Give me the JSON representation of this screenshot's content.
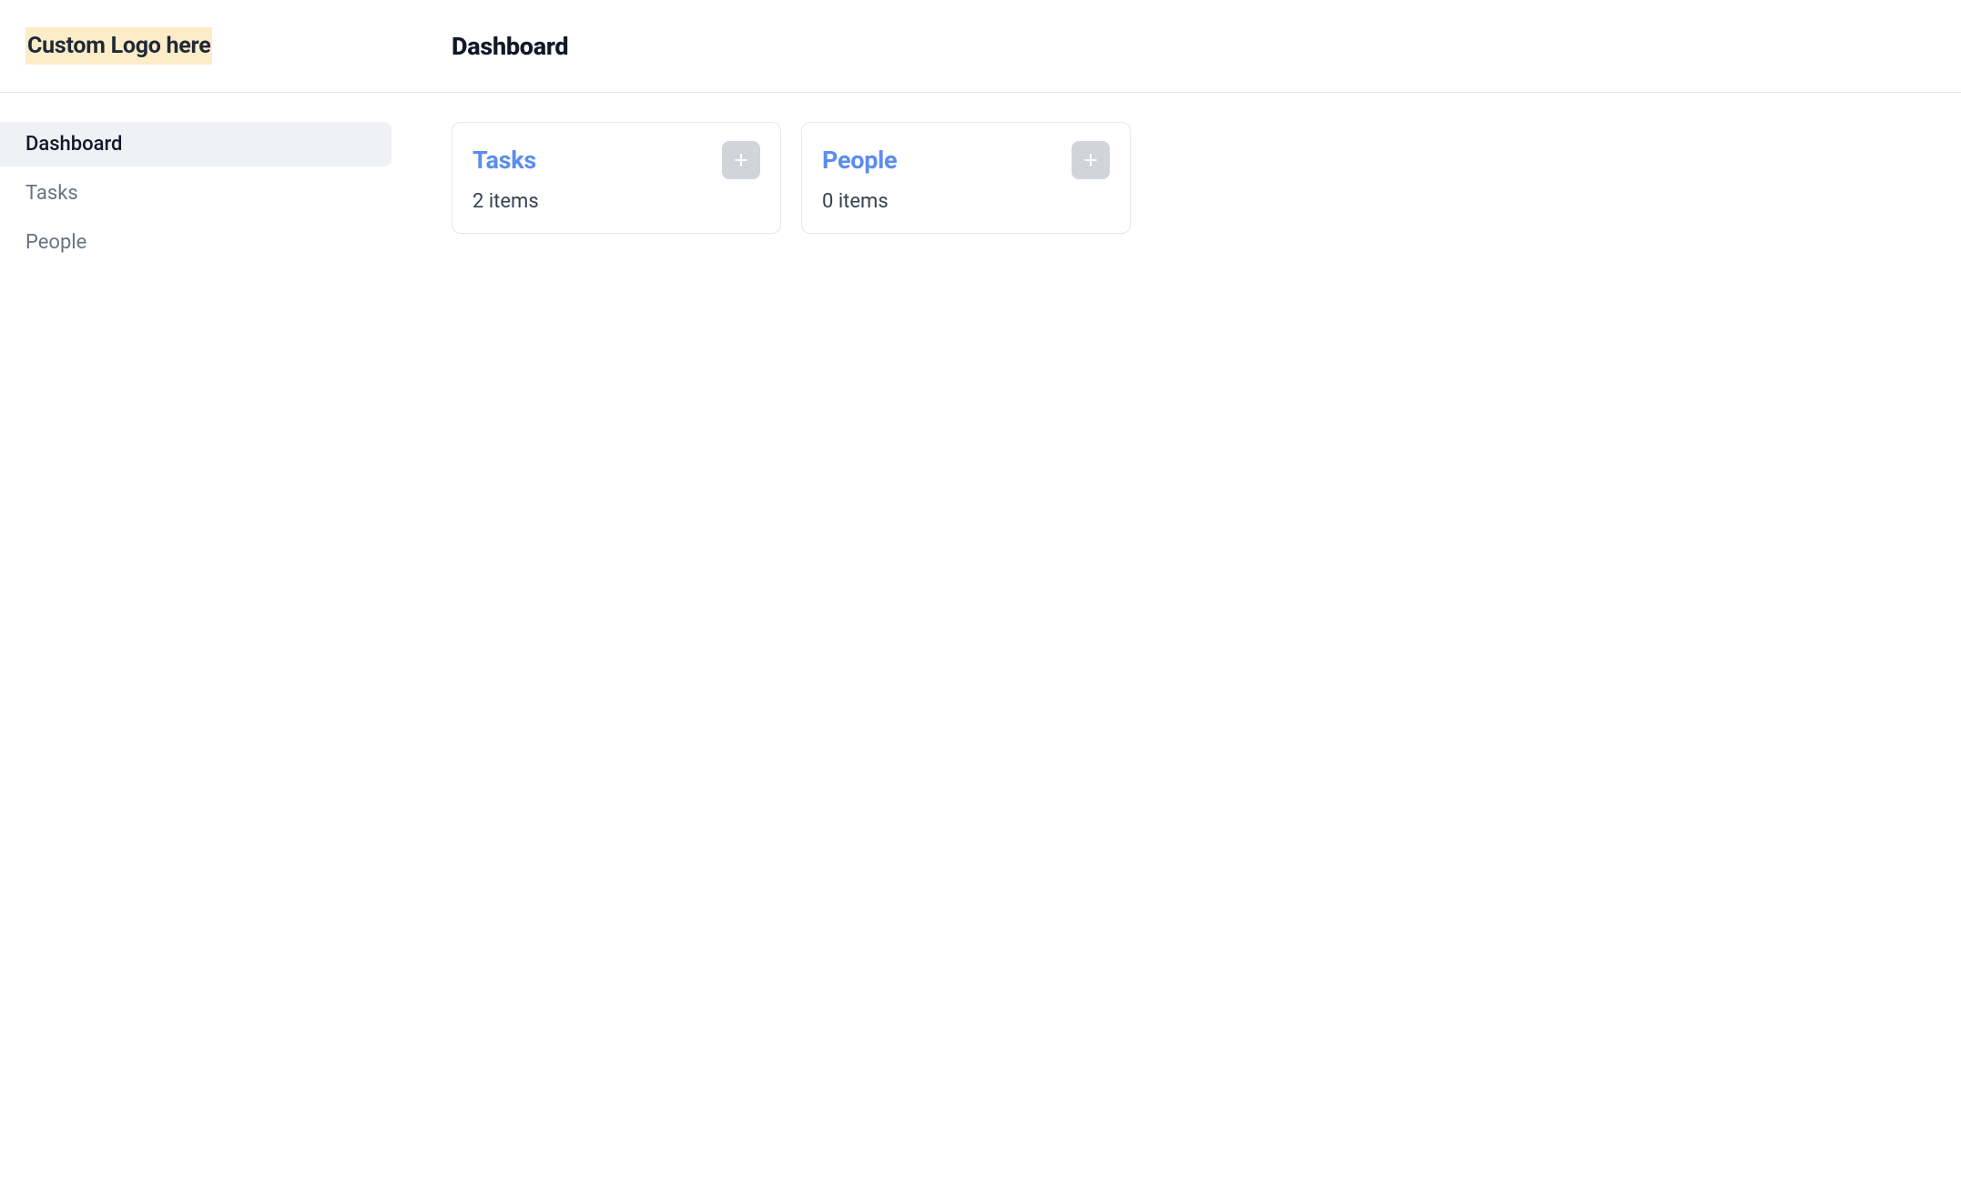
{
  "logo": {
    "text": "Custom Logo here"
  },
  "header": {
    "title": "Dashboard"
  },
  "sidebar": {
    "items": [
      {
        "label": "Dashboard",
        "active": true
      },
      {
        "label": "Tasks",
        "active": false
      },
      {
        "label": "People",
        "active": false
      }
    ]
  },
  "cards": [
    {
      "title": "Tasks",
      "subtitle": "2 items"
    },
    {
      "title": "People",
      "subtitle": "0 items"
    }
  ]
}
